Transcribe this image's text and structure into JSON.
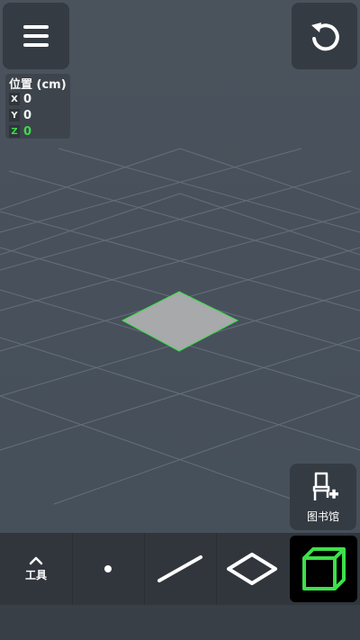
{
  "position_panel": {
    "title": "位置 (cm)",
    "axes": [
      {
        "axis": "X",
        "value": "0"
      },
      {
        "axis": "Y",
        "value": "0"
      },
      {
        "axis": "Z",
        "value": "0"
      }
    ]
  },
  "library": {
    "label": "图书馆"
  },
  "toolbar": {
    "tools_label": "工具"
  },
  "icons": {
    "menu": "hamburger-icon",
    "undo": "undo-icon",
    "library": "chair-add-icon",
    "tools": "chevron-up-icon",
    "point": "point-icon",
    "line": "line-icon",
    "plane": "plane-icon",
    "cube": "cube-icon"
  },
  "colors": {
    "background": "#48505b",
    "panel": "#353b43",
    "active_accent": "#3ee04a",
    "selected_plane": "#a7a9aa"
  }
}
